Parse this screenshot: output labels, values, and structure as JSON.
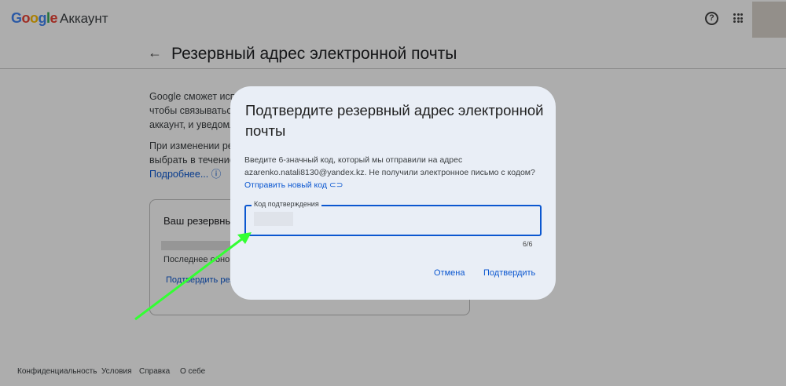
{
  "header": {
    "logo": "Google",
    "product": "Аккаунт",
    "help_icon": "help-circle-icon",
    "apps_icon": "apps-grid-icon"
  },
  "page": {
    "title": "Резервный адрес электронной почты",
    "para1": [
      "Google сможет исп",
      "чтобы связываться",
      "аккаунт, и уведомл"
    ],
    "para2": [
      "При изменении ре",
      "выбрать в течение"
    ],
    "learn_more": "Подробнее...",
    "card": {
      "title": "Ваш резервны",
      "email_suffix": "li",
      "updated": "Последнее обнов",
      "confirm_link": "Подтвердить рез"
    }
  },
  "footer": [
    "Конфиденциальность",
    "Условия",
    "Справка",
    "О себе"
  ],
  "dialog": {
    "title": "Подтвердите резервный адрес электронной почты",
    "text1": "Введите 6-значный код, который мы отправили на адрес",
    "text2": "azarenko.natali8130@yandex.kz. Не получили электронное письмо с кодом?",
    "resend": "Отправить новый код",
    "field_label": "Код подтверждения",
    "counter": "6/6",
    "cancel": "Отмена",
    "confirm": "Подтвердить"
  },
  "colors": {
    "accent": "#0b57d0",
    "annotation_arrow": "#33ff33"
  }
}
